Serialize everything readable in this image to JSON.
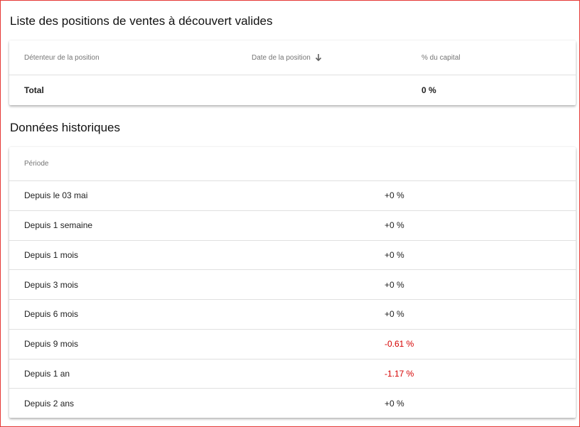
{
  "shorts": {
    "title": "Liste des positions de ventes à découvert valides",
    "columns": {
      "holder": "Détenteur de la position",
      "date": "Date de la position",
      "capital": "% du capital"
    },
    "total": {
      "label": "Total",
      "value": "0 %"
    }
  },
  "historical": {
    "title": "Données historiques",
    "column_period": "Période",
    "rows": [
      {
        "period": "Depuis le 03 mai",
        "value": "+0 %"
      },
      {
        "period": "Depuis 1 semaine",
        "value": "+0 %"
      },
      {
        "period": "Depuis 1 mois",
        "value": "+0 %"
      },
      {
        "period": "Depuis 3 mois",
        "value": "+0 %"
      },
      {
        "period": "Depuis 6 mois",
        "value": "+0 %"
      },
      {
        "period": "Depuis 9 mois",
        "value": "-0.61 %"
      },
      {
        "period": "Depuis 1 an",
        "value": "-1.17 %"
      },
      {
        "period": "Depuis 2 ans",
        "value": "+0 %"
      }
    ]
  },
  "colors": {
    "negative": "#d50000",
    "frame": "#e53935"
  },
  "icons": {
    "sort": "arrow-down-icon"
  }
}
